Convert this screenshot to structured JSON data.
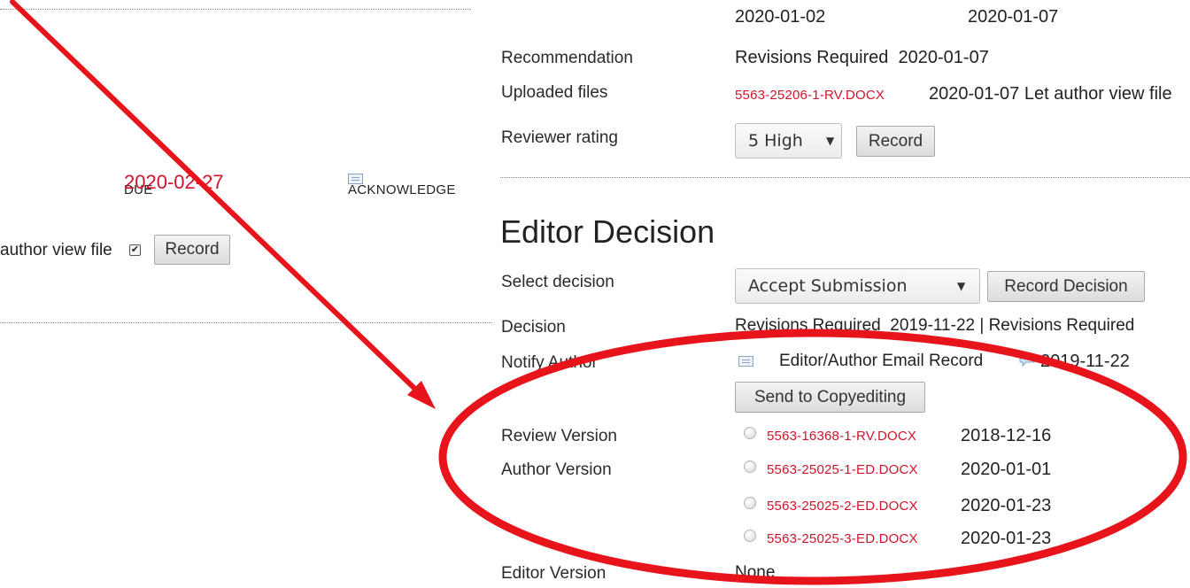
{
  "left_panel": {
    "due_header": "DUE",
    "acknowledge_header": "ACKNOWLEDGE",
    "due_date": "2020-02-27",
    "author_view_label": "author view file",
    "author_view_checked": true,
    "record_button": "Record"
  },
  "review_top": {
    "date_1": "2020-01-02",
    "date_2": "2020-01-07",
    "recommendation_label": "Recommendation",
    "recommendation_value": "Revisions Required  2020-01-07",
    "uploaded_label": "Uploaded files",
    "uploaded_file": "5563-25206-1-RV.DOCX",
    "uploaded_rest": "2020-01-07 Let author view file",
    "rating_label": "Reviewer rating",
    "rating_value": "5 High",
    "rating_record_button": "Record"
  },
  "editor_decision": {
    "heading": "Editor Decision",
    "select_label": "Select decision",
    "select_value": "Accept Submission",
    "record_decision_button": "Record Decision",
    "decision_label": "Decision",
    "decision_value": "Revisions Required  2019-11-22 | Revisions Required",
    "notify_label": "Notify Author",
    "notify_text": "Editor/Author Email Record",
    "notify_date": "2019-11-22",
    "send_copyediting_button": "Send to Copyediting",
    "review_version_label": "Review Version",
    "review_version": {
      "file": "5563-16368-1-RV.DOCX",
      "date": "2018-12-16"
    },
    "author_version_label": "Author Version",
    "author_versions": [
      {
        "file": "5563-25025-1-ED.DOCX",
        "date": "2020-01-01"
      },
      {
        "file": "5563-25025-2-ED.DOCX",
        "date": "2020-01-23"
      },
      {
        "file": "5563-25025-3-ED.DOCX",
        "date": "2020-01-23"
      }
    ],
    "editor_version_label": "Editor Version",
    "editor_version_value": "None"
  },
  "colors": {
    "link": "#d0142c",
    "annotation": "#e8141c"
  },
  "icons": [
    "mail-icon",
    "comment-icon",
    "caret-down-icon",
    "radio-icon",
    "checkbox-icon"
  ]
}
